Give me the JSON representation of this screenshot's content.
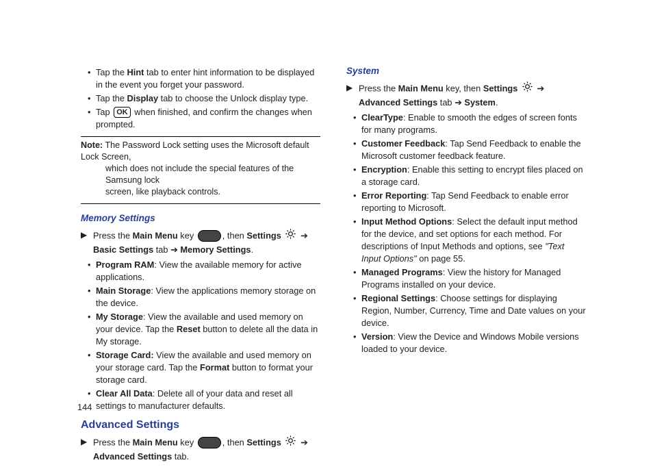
{
  "pageNumber": "144",
  "arrow": "➔",
  "left": {
    "topBullets": [
      {
        "pre": "Tap the ",
        "bold": "Hint",
        "post": " tab to enter hint information to be displayed in the event you forget your password."
      },
      {
        "pre": "Tap the ",
        "bold": "Display",
        "post": " tab to choose the Unlock display type."
      }
    ],
    "okBullet": {
      "pre": "Tap ",
      "ok": "OK",
      "post": " when finished, and confirm the changes when prompted."
    },
    "note": {
      "lead": "Note:",
      "t1": " The Password Lock setting uses the Microsoft default Lock Screen,",
      "t2": "which does not include the special features of the Samsung lock",
      "t3": "screen, like playback controls."
    },
    "memory": {
      "header": "Memory Settings",
      "step": {
        "p1": "Press the ",
        "b1": "Main Menu",
        "p2": " key ",
        "p3": ", then ",
        "b2": "Settings",
        "p4": " ",
        "p5": " ",
        "b3": "Basic Settings",
        "p6": " tab ",
        "b4": "Memory Settings",
        "p7": "."
      },
      "bullets": [
        {
          "bold": "Program RAM",
          "text": ": View the available memory for active applications."
        },
        {
          "bold": "Main Storage",
          "text": ": View the applications memory storage on the device."
        },
        {
          "bold": "My Storage",
          "text": ": View the available and used memory on your device. Tap the ",
          "bold2": "Reset",
          "text2": " button to delete all the data in My storage."
        },
        {
          "bold": "Storage Card:",
          "text": " View the available and used memory on your storage card. Tap the ",
          "bold2": "Format",
          "text2": " button to format your storage card."
        },
        {
          "bold": "Clear All Data",
          "text": ": Delete all of your data and reset all settings to manufacturer defaults."
        }
      ]
    },
    "advanced": {
      "header": "Advanced Settings",
      "step": {
        "p1": "Press the ",
        "b1": "Main Menu",
        "p2": " key ",
        "p3": ", then ",
        "b2": "Settings",
        "p4": " ",
        "p5": " ",
        "b3": "Advanced Settings",
        "p6": " tab."
      }
    }
  },
  "right": {
    "system": {
      "header": "System",
      "step": {
        "p1": "Press the ",
        "b1": "Main Menu",
        "p2": " key, then ",
        "b2": "Settings",
        "p3": " ",
        "p4": " ",
        "b3": "Advanced Settings",
        "p5": " tab ",
        "b4": "System",
        "p6": "."
      },
      "bullets": [
        {
          "bold": "ClearType",
          "text": ": Enable to smooth the edges of screen fonts for many programs."
        },
        {
          "bold": "Customer Feedback",
          "text": ": Tap Send Feedback to enable the Microsoft customer feedback feature."
        },
        {
          "bold": "Encryption",
          "text": ": Enable this setting to encrypt files placed on a storage card."
        },
        {
          "bold": "Error Reporting",
          "text": ": Tap Send Feedback to enable error reporting to Microsoft."
        },
        {
          "bold": "Input Method Options",
          "text": ": Select the default input method for the device, and set options for each method.  For descriptions of Input Methods and options, see ",
          "italic": "\"Text Input Options\"",
          "text2": " on page 55."
        },
        {
          "bold": "Managed Programs",
          "text": ": View the history for Managed Programs installed on your device."
        },
        {
          "bold": "Regional Settings",
          "text": ": Choose settings for displaying Region, Number, Currency, Time and Date values on your device."
        },
        {
          "bold": "Version",
          "text": ": View the Device and Windows Mobile versions loaded to your device."
        }
      ]
    }
  }
}
